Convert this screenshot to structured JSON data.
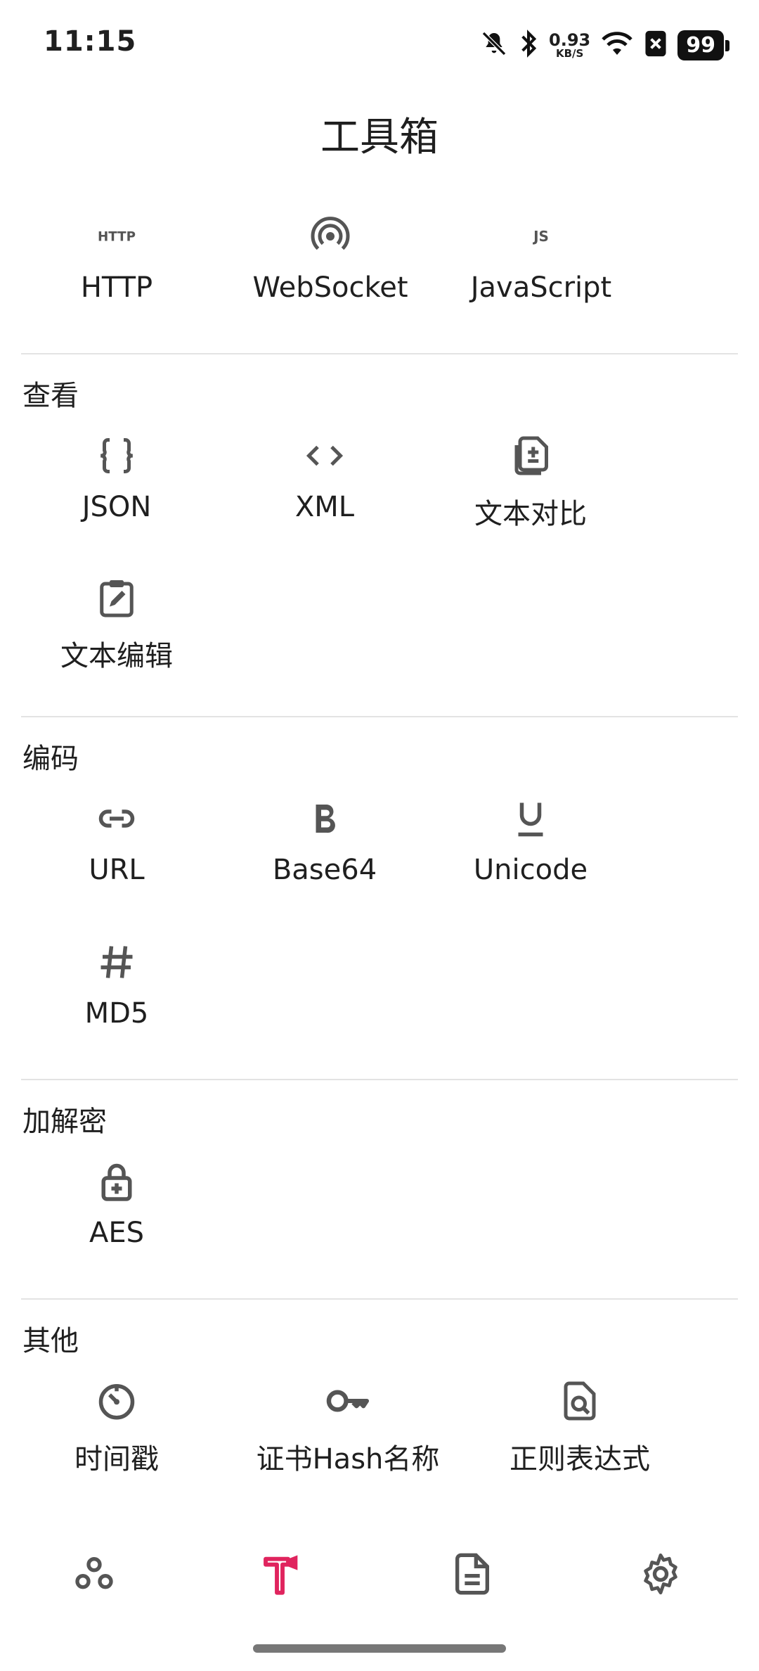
{
  "status_bar": {
    "time": "11:15",
    "net_speed_value": "0.93",
    "net_speed_unit": "KB/S",
    "battery": "99",
    "icons": [
      "mute-icon",
      "bluetooth-icon",
      "wifi-icon",
      "close-box-icon"
    ]
  },
  "page": {
    "title": "工具箱"
  },
  "top_tools": [
    {
      "label": "HTTP",
      "icon": "http-icon"
    },
    {
      "label": "WebSocket",
      "icon": "broadcast-icon"
    },
    {
      "label": "JavaScript",
      "icon": "js-icon"
    }
  ],
  "sections": [
    {
      "title": "查看",
      "items": [
        {
          "label": "JSON",
          "icon": "braces-icon"
        },
        {
          "label": "XML",
          "icon": "code-icon"
        },
        {
          "label": "文本对比",
          "icon": "file-compare-icon"
        },
        {
          "label": "文本编辑",
          "icon": "clipboard-edit-icon"
        }
      ]
    },
    {
      "title": "编码",
      "items": [
        {
          "label": "URL",
          "icon": "link-icon"
        },
        {
          "label": "Base64",
          "icon": "bold-icon"
        },
        {
          "label": "Unicode",
          "icon": "underline-icon"
        },
        {
          "label": "MD5",
          "icon": "hash-icon"
        }
      ]
    },
    {
      "title": "加解密",
      "items": [
        {
          "label": "AES",
          "icon": "lock-plus-icon"
        }
      ]
    },
    {
      "title": "其他",
      "items": [
        {
          "label": "时间戳",
          "icon": "timer-icon"
        },
        {
          "label": "证书Hash名称",
          "icon": "key-icon"
        },
        {
          "label": "正则表达式",
          "icon": "doc-search-icon"
        }
      ]
    }
  ],
  "bottom_nav": {
    "items": [
      "bubbles-icon",
      "hammer-icon",
      "document-icon",
      "gear-icon"
    ],
    "active": "hammer-icon",
    "active_color": "#e0245e",
    "inactive_color": "#555555"
  }
}
